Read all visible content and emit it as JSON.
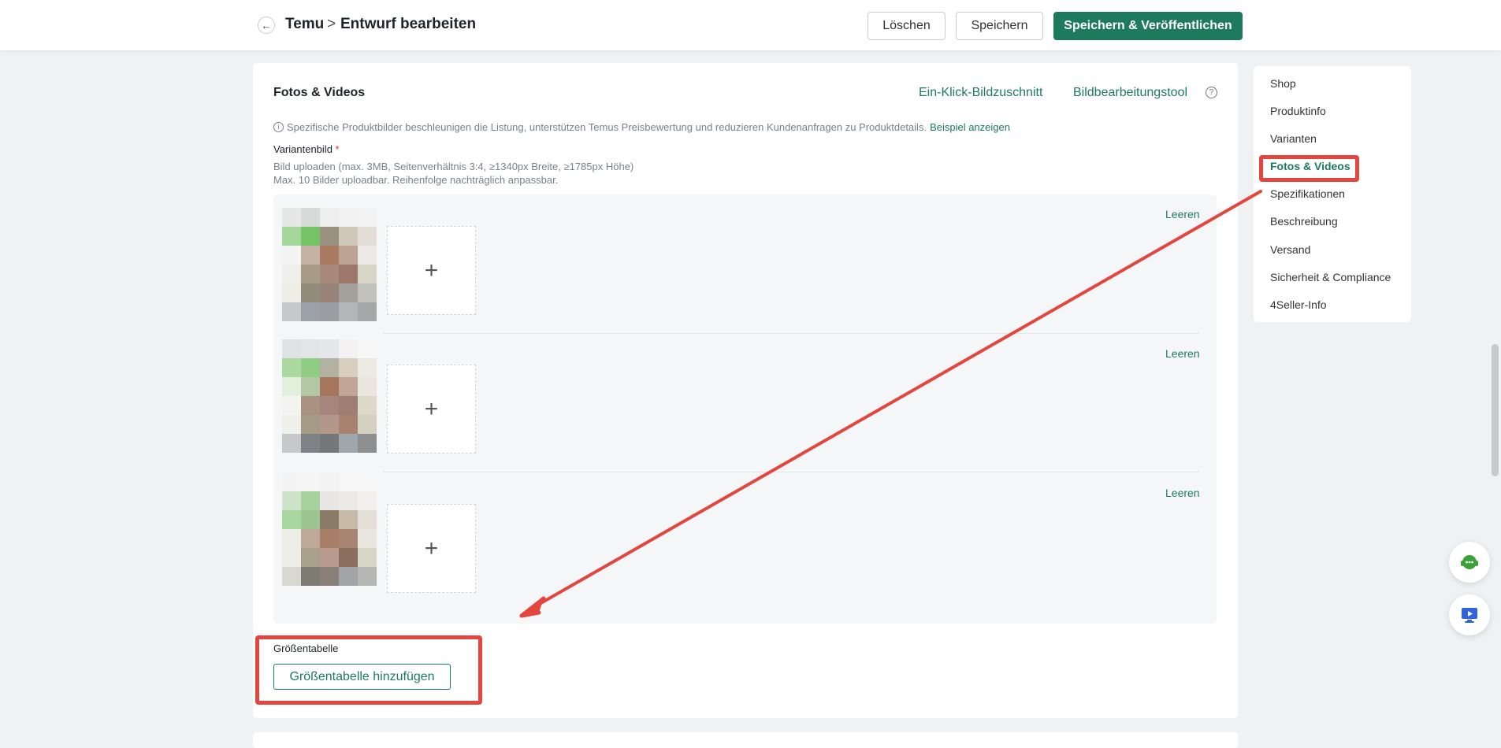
{
  "header": {
    "breadcrumb_shop": "Temu",
    "breadcrumb_sep": ">",
    "breadcrumb_page": "Entwurf bearbeiten",
    "delete_label": "Löschen",
    "save_label": "Speichern",
    "publish_label": "Speichern & Veröffentlichen"
  },
  "section": {
    "title": "Fotos & Videos",
    "crop_tool": "Ein-Klick-Bildzuschnitt",
    "edit_tool": "Bildbearbeitungstool",
    "tip": "Spezifische Produktbilder beschleunigen die Listung, unterstützen Temus Preisbewertung und reduzieren Kundenanfragen zu Produktdetails.",
    "tip_link": "Beispiel anzeigen",
    "variant_label": "Variantenbild",
    "required_mark": "*",
    "hint_1": "Bild uploaden (max. 3MB, Seitenverhältnis 3:4, ≥1340px Breite, ≥1785px Höhe)",
    "hint_2": "Max. 10 Bilder uploadbar. Reihenfolge nachträglich anpassbar.",
    "variants": [
      {
        "clear_label": "Leeren",
        "add_symbol": "+"
      },
      {
        "clear_label": "Leeren",
        "add_symbol": "+"
      },
      {
        "clear_label": "Leeren",
        "add_symbol": "+"
      }
    ],
    "size_table_label": "Größentabelle",
    "size_table_button": "Größentabelle hinzufügen"
  },
  "side_nav": {
    "items": [
      "Shop",
      "Produktinfo",
      "Varianten",
      "Fotos & Videos",
      "Spezifikationen",
      "Beschreibung",
      "Versand",
      "Sicherheit & Compliance",
      "4Seller-Info"
    ],
    "active": "Fotos & Videos"
  },
  "floating": {
    "support_icon": "headset-icon",
    "tutorial_icon": "screen-play-icon"
  },
  "colors": {
    "accent": "#1e7a5c",
    "highlight": "#e2463e",
    "required": "#e0303a"
  }
}
